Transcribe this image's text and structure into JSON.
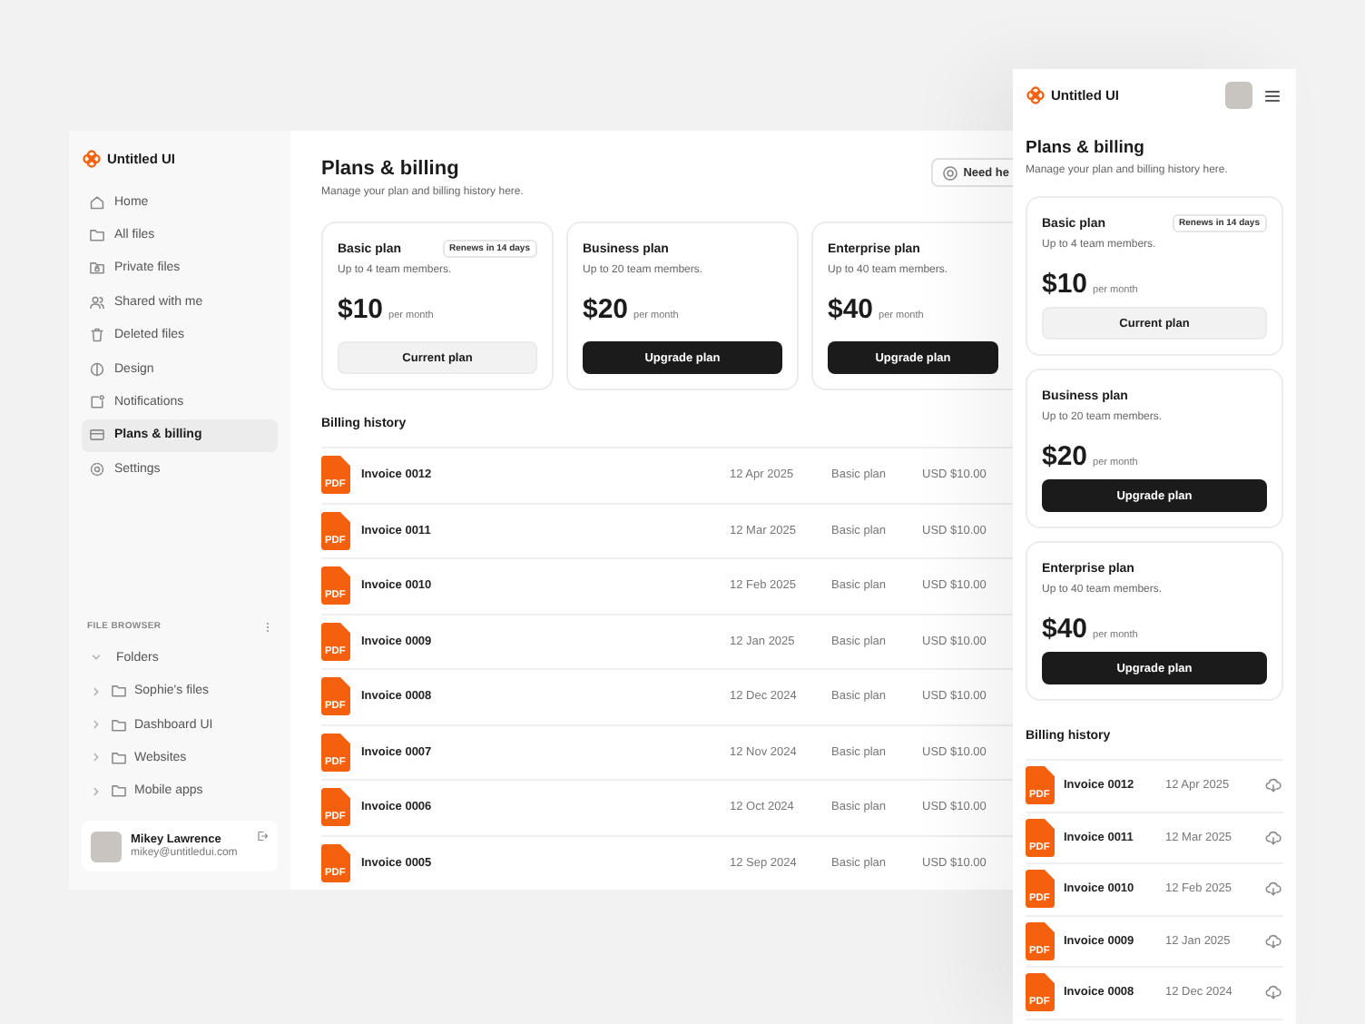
{
  "desktop": {
    "sidebar": {
      "brand": "Untitled UI",
      "nav": [
        {
          "label": "Home",
          "selected": false
        },
        {
          "label": "All files",
          "selected": false
        },
        {
          "label": "Private files",
          "selected": false
        },
        {
          "label": "Shared with me",
          "selected": false
        },
        {
          "label": "Deleted files",
          "selected": false
        },
        {
          "label": "Design",
          "selected": false
        },
        {
          "label": "Notifications",
          "selected": false
        },
        {
          "label": "Plans & billing",
          "selected": true
        },
        {
          "label": "Settings",
          "selected": false
        }
      ],
      "file_browser": {
        "heading": "FILE BROWSER",
        "folders": [
          {
            "label": "Folders",
            "expanded": true,
            "children": [
              {
                "label": "Sophie's files",
                "expanded": false
              },
              {
                "label": "Dashboard UI",
                "expanded": false
              },
              {
                "label": "Websites",
                "expanded": false
              },
              {
                "label": "Mobile apps",
                "expanded": false
              }
            ]
          }
        ]
      },
      "user": {
        "name": "Mikey Lawrence",
        "email": "mikey@untitledui.com"
      }
    },
    "header": {
      "title": "Plans & billing",
      "subtitle": "Manage your plan and billing history here.",
      "help_button": "Need he"
    },
    "plans": [
      {
        "name": "Basic plan",
        "badge": "Renews in 14 days",
        "members": "Up to 4 team members.",
        "price": "$10",
        "period": "per month",
        "button": "Current plan",
        "current": true
      },
      {
        "name": "Business plan",
        "members": "Up to 20 team members.",
        "price": "$20",
        "period": "per month",
        "button": "Upgrade plan",
        "current": false
      },
      {
        "name": "Enterprise plan",
        "members": "Up to 40 team members.",
        "price": "$40",
        "period": "per month",
        "button": "Upgrade plan",
        "current": false
      }
    ],
    "billing": {
      "title": "Billing history",
      "rows": [
        {
          "file_type": "PDF",
          "invoice": "Invoice 0012",
          "date": "12 Apr 2025",
          "plan": "Basic plan",
          "amount": "USD $10.00"
        },
        {
          "file_type": "PDF",
          "invoice": "Invoice 0011",
          "date": "12 Mar 2025",
          "plan": "Basic plan",
          "amount": "USD $10.00"
        },
        {
          "file_type": "PDF",
          "invoice": "Invoice 0010",
          "date": "12 Feb 2025",
          "plan": "Basic plan",
          "amount": "USD $10.00"
        },
        {
          "file_type": "PDF",
          "invoice": "Invoice 0009",
          "date": "12 Jan 2025",
          "plan": "Basic plan",
          "amount": "USD $10.00"
        },
        {
          "file_type": "PDF",
          "invoice": "Invoice 0008",
          "date": "12 Dec 2024",
          "plan": "Basic plan",
          "amount": "USD $10.00"
        },
        {
          "file_type": "PDF",
          "invoice": "Invoice 0007",
          "date": "12 Nov 2024",
          "plan": "Basic plan",
          "amount": "USD $10.00"
        },
        {
          "file_type": "PDF",
          "invoice": "Invoice 0006",
          "date": "12 Oct 2024",
          "plan": "Basic plan",
          "amount": "USD $10.00"
        },
        {
          "file_type": "PDF",
          "invoice": "Invoice 0005",
          "date": "12 Sep 2024",
          "plan": "Basic plan",
          "amount": "USD $10.00"
        }
      ]
    }
  },
  "mobile": {
    "brand": "Untitled UI",
    "header": {
      "title": "Plans & billing",
      "subtitle": "Manage your plan and billing history here."
    },
    "plans": [
      {
        "name": "Basic plan",
        "badge": "Renews in 14 days",
        "members": "Up to 4 team members.",
        "price": "$10",
        "period": "per month",
        "button": "Current plan",
        "current": true
      },
      {
        "name": "Business plan",
        "members": "Up to 20 team members.",
        "price": "$20",
        "period": "per month",
        "button": "Upgrade plan",
        "current": false
      },
      {
        "name": "Enterprise plan",
        "members": "Up to 40 team members.",
        "price": "$40",
        "period": "per month",
        "button": "Upgrade plan",
        "current": false
      }
    ],
    "billing": {
      "title": "Billing history",
      "rows": [
        {
          "file_type": "PDF",
          "invoice": "Invoice 0012",
          "date": "12 Apr 2025"
        },
        {
          "file_type": "PDF",
          "invoice": "Invoice 0011",
          "date": "12 Mar 2025"
        },
        {
          "file_type": "PDF",
          "invoice": "Invoice 0010",
          "date": "12 Feb 2025"
        },
        {
          "file_type": "PDF",
          "invoice": "Invoice 0009",
          "date": "12 Jan 2025"
        },
        {
          "file_type": "PDF",
          "invoice": "Invoice 0008",
          "date": "12 Dec 2024"
        }
      ]
    }
  }
}
